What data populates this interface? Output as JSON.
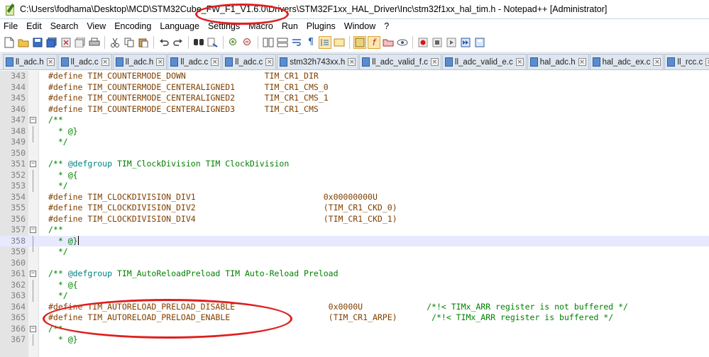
{
  "window": {
    "title": "C:\\Users\\fodhama\\Desktop\\MCD\\STM32Cube_FW_F1_V1.6.0\\Drivers\\STM32F1xx_HAL_Driver\\Inc\\stm32f1xx_hal_tim.h - Notepad++ [Administrator]"
  },
  "menu": [
    "File",
    "Edit",
    "Search",
    "View",
    "Encoding",
    "Language",
    "Settings",
    "Macro",
    "Run",
    "Plugins",
    "Window",
    "?"
  ],
  "tabs": [
    "ll_adc.h",
    "ll_adc.c",
    "ll_adc.h",
    "ll_adc.c",
    "ll_adc.c",
    "stm32h743xx.h",
    "ll_adc_valid_f.c",
    "ll_adc_valid_e.c",
    "hal_adc.h",
    "hal_adc_ex.c",
    "ll_rcc.c",
    "l"
  ],
  "tab_close_glyph": "×",
  "fold": {
    "open": "−"
  },
  "colors": {
    "annotation": "#e01f1f",
    "preprocessor": "#804000",
    "comment": "#008000",
    "doc_keyword": "#008080"
  },
  "lines": [
    {
      "n": "343",
      "pre": "#define TIM_COUNTERMODE_DOWN                TIM_CR1_DIR"
    },
    {
      "n": "344",
      "pre": "#define TIM_COUNTERMODE_CENTERALIGNED1      TIM_CR1_CMS_0"
    },
    {
      "n": "345",
      "pre": "#define TIM_COUNTERMODE_CENTERALIGNED2      TIM_CR1_CMS_1"
    },
    {
      "n": "346",
      "pre": "#define TIM_COUNTERMODE_CENTERALIGNED3      TIM_CR1_CMS"
    },
    {
      "n": "347",
      "cm": "/**"
    },
    {
      "n": "348",
      "cm": "  * @}"
    },
    {
      "n": "349",
      "cm": "  */"
    },
    {
      "n": "350"
    },
    {
      "n": "351",
      "cm": "/** ",
      "cmd": "@defgroup",
      "cm2": " TIM_ClockDivision TIM ClockDivision"
    },
    {
      "n": "352",
      "cm": "  * @{"
    },
    {
      "n": "353",
      "cm": "  */"
    },
    {
      "n": "354",
      "pre": "#define TIM_CLOCKDIVISION_DIV1                          0x00000000U"
    },
    {
      "n": "355",
      "pre": "#define TIM_CLOCKDIVISION_DIV2                          (TIM_CR1_CKD_0)"
    },
    {
      "n": "356",
      "pre": "#define TIM_CLOCKDIVISION_DIV4                          (TIM_CR1_CKD_1)"
    },
    {
      "n": "357",
      "cm": "/**"
    },
    {
      "n": "358",
      "cm": "  * @}"
    },
    {
      "n": "359",
      "cm": "  */"
    },
    {
      "n": "360"
    },
    {
      "n": "361",
      "cm": "/** ",
      "cmd": "@defgroup",
      "cm2": " TIM_AutoReloadPreload TIM Auto-Reload Preload"
    },
    {
      "n": "362",
      "cm": "  * @{"
    },
    {
      "n": "363",
      "cm": "  */"
    },
    {
      "n": "364",
      "pre": "#define TIM_AUTORELOAD_PRELOAD_DISABLE                   0x0000U",
      "cm_tail": "             /*!< TIMx_ARR register is not buffered */"
    },
    {
      "n": "365",
      "pre": "#define TIM_AUTORELOAD_PRELOAD_ENABLE                    (TIM_CR1_ARPE)",
      "cm_tail": "       /*!< TIMx_ARR register is buffered */"
    },
    {
      "n": "366",
      "cm": "/**"
    },
    {
      "n": "367",
      "cm": "  * @}"
    }
  ]
}
